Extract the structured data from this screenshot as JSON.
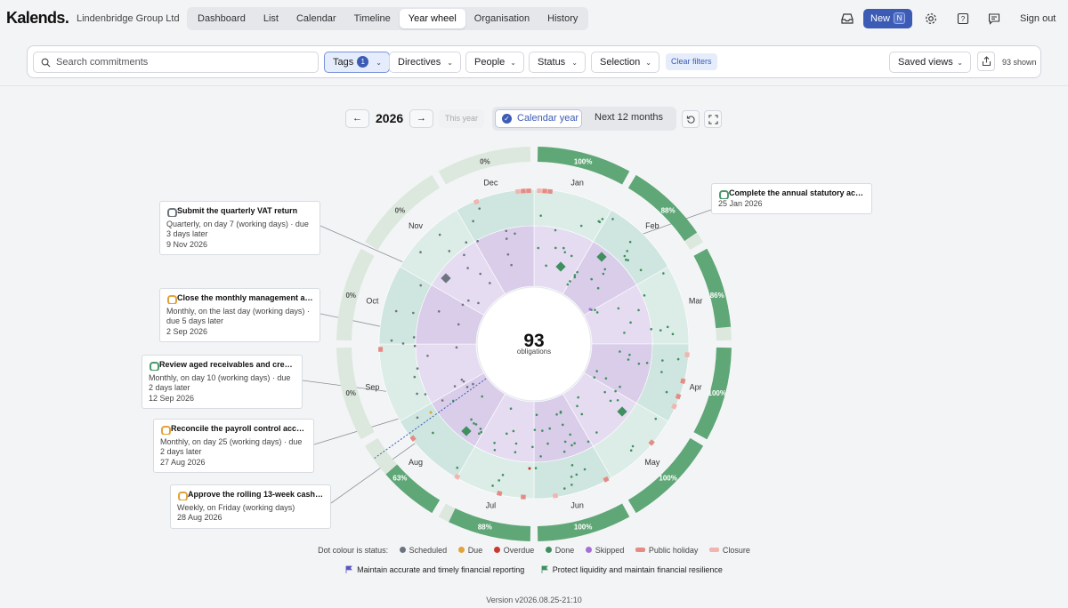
{
  "brand": {
    "logo": "Kalends.",
    "org": "Lindenbridge Group Ltd"
  },
  "nav": {
    "tabs": [
      "Dashboard",
      "List",
      "Calendar",
      "Timeline",
      "Year wheel",
      "Organisation",
      "History"
    ],
    "active": "Year wheel"
  },
  "topbar": {
    "new_label": "New",
    "new_shortcut": "N",
    "signout": "Sign out",
    "icons": [
      "inbox-icon",
      "gear-icon",
      "help-icon",
      "feedback-icon"
    ]
  },
  "filters": {
    "search_placeholder": "Search commitments",
    "tags_label": "Tags",
    "tags_count": "1",
    "directives_label": "Directives",
    "people_label": "People",
    "status_label": "Status",
    "selection_label": "Selection",
    "clear_label": "Clear filters",
    "saved_views_label": "Saved views",
    "shown_text": "93 shown"
  },
  "yearbar": {
    "year": "2026",
    "this_year": "This year",
    "mode_calendar": "Calendar year",
    "mode_next": "Next 12 months"
  },
  "wheel": {
    "center_count": "93",
    "center_label": "obligations",
    "months": [
      "Jan",
      "Feb",
      "Mar",
      "Apr",
      "May",
      "Jun",
      "Jul",
      "Aug",
      "Sep",
      "Oct",
      "Nov",
      "Dec"
    ],
    "completion": [
      "100%",
      "88%",
      "86%",
      "100%",
      "100%",
      "100%",
      "88%",
      "63%",
      "0%",
      "0%",
      "0%",
      "0%"
    ],
    "completion_fraction": [
      1.0,
      0.88,
      0.86,
      1.0,
      1.0,
      1.0,
      0.88,
      0.63,
      0,
      0,
      0,
      0
    ]
  },
  "callouts": [
    {
      "title": "Submit the quarterly VAT return",
      "desc": "Quarterly, on day 7 (working days) · due 3 days later",
      "date": "9 Nov 2026",
      "status": "scheduled"
    },
    {
      "title": "Close the monthly management acc...",
      "desc": "Monthly, on the last day (working days) · due 5 days later",
      "date": "2 Sep 2026",
      "status": "due"
    },
    {
      "title": "Review aged receivables and credi...",
      "desc": "Monthly, on day 10 (working days) · due 2 days later",
      "date": "12 Sep 2026",
      "status": "done"
    },
    {
      "title": "Reconcile the payroll control acco...",
      "desc": "Monthly, on day 25 (working days) · due 2 days later",
      "date": "27 Aug 2026",
      "status": "due"
    },
    {
      "title": "Approve the rolling 13-week cash ...",
      "desc": "Weekly, on Friday (working days)",
      "date": "28 Aug 2026",
      "status": "due"
    },
    {
      "title": "Complete the annual statutory acc...",
      "desc": "",
      "date": "25 Jan 2026",
      "status": "done"
    }
  ],
  "legend": {
    "intro": "Dot colour is status:",
    "items": [
      {
        "label": "Scheduled",
        "color": "#6d7480"
      },
      {
        "label": "Due",
        "color": "#e2a23a"
      },
      {
        "label": "Overdue",
        "color": "#c8392e"
      },
      {
        "label": "Done",
        "color": "#3f8f5f"
      },
      {
        "label": "Skipped",
        "color": "#a66fd6"
      },
      {
        "label": "Public holiday",
        "color": "#e58b84"
      },
      {
        "label": "Closure",
        "color": "#f2b4ae"
      }
    ],
    "directives": [
      {
        "label": "Maintain accurate and timely financial reporting",
        "color": "#5a55c6"
      },
      {
        "label": "Protect liquidity and maintain financial resilience",
        "color": "#3f8f5f"
      }
    ]
  },
  "footer": {
    "version": "Version v2026.08.25-21:10"
  },
  "colors": {
    "accent": "#3b5bb5",
    "done_ring": "#5fa777",
    "empty_ring": "#dce8de"
  }
}
